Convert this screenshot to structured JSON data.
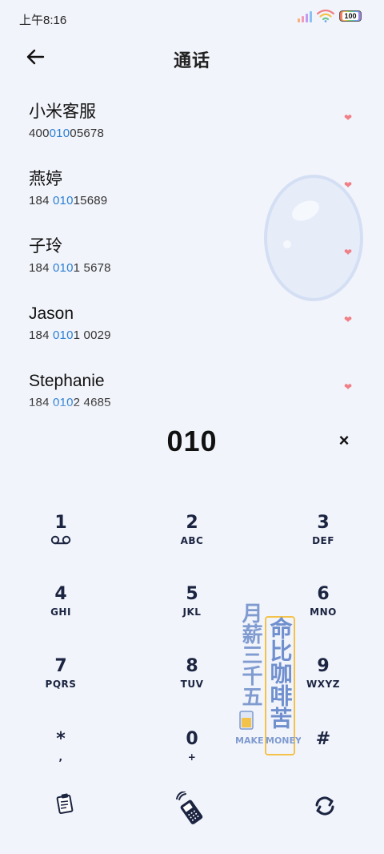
{
  "status_bar": {
    "time": "上午8:16",
    "battery": "100"
  },
  "header": {
    "title": "通话"
  },
  "contacts": [
    {
      "name": "小米客服",
      "number_pre": "400",
      "number_match": "010",
      "number_post": "05678"
    },
    {
      "name": "燕婷",
      "number_pre": "184 ",
      "number_match": "010",
      "number_post": "15689"
    },
    {
      "name": "子玲",
      "number_pre": "184 ",
      "number_match": "010",
      "number_post": "1 5678"
    },
    {
      "name": "Jason",
      "number_pre": "184 ",
      "number_match": "010",
      "number_post": "1 0029"
    },
    {
      "name": "Stephanie",
      "number_pre": "184 ",
      "number_match": "010",
      "number_post": "2 4685"
    }
  ],
  "dial": {
    "input": "010",
    "clear_symbol": "×"
  },
  "keys": [
    {
      "digit": "1",
      "letters": "oo"
    },
    {
      "digit": "2",
      "letters": "ABC"
    },
    {
      "digit": "3",
      "letters": "DEF"
    },
    {
      "digit": "4",
      "letters": "GHI"
    },
    {
      "digit": "5",
      "letters": "JKL"
    },
    {
      "digit": "6",
      "letters": "MNO"
    },
    {
      "digit": "7",
      "letters": "PQRS"
    },
    {
      "digit": "8",
      "letters": "TUV"
    },
    {
      "digit": "9",
      "letters": "WXYZ"
    },
    {
      "digit": "*",
      "letters": ","
    },
    {
      "digit": "0",
      "letters": "+"
    },
    {
      "digit": "#",
      "letters": ""
    }
  ],
  "sticker": {
    "line1": "月薪三千五",
    "line2": "命比咖啡苦",
    "make": "MAKE",
    "money": "MONEY"
  },
  "colors": {
    "background": "#f2f4fb",
    "match_highlight": "#2a7fd4",
    "heart": "#f07f86",
    "key_text": "#1b2440"
  }
}
